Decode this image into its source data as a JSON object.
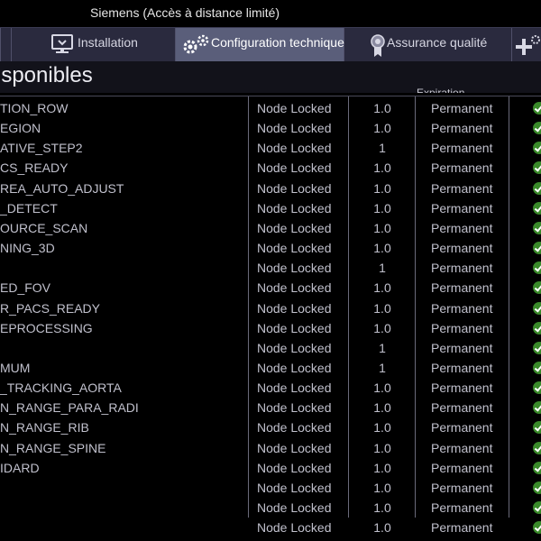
{
  "window": {
    "title": "Siemens (Accès à distance limité)"
  },
  "tabs": [
    {
      "label": "Installation",
      "icon": "monitor-icon",
      "active": false
    },
    {
      "label": "Configuration technique",
      "icon": "gears-icon",
      "active": true
    },
    {
      "label": "Assurance qualité",
      "icon": "award-icon",
      "active": false
    },
    {
      "label": "",
      "icon": "plus-gear-icon",
      "active": false
    }
  ],
  "section": {
    "title": "isponibles",
    "expiration_header": "Expiration"
  },
  "options": [
    {
      "name": "TION_ROW",
      "license": "Node Locked",
      "version": "1.0",
      "validity": "Permanent"
    },
    {
      "name": "EGION",
      "license": "Node Locked",
      "version": "1.0",
      "validity": "Permanent"
    },
    {
      "name": "ATIVE_STEP2",
      "license": "Node Locked",
      "version": "1",
      "validity": "Permanent"
    },
    {
      "name": "CS_READY",
      "license": "Node Locked",
      "version": "1.0",
      "validity": "Permanent"
    },
    {
      "name": "REA_AUTO_ADJUST",
      "license": "Node Locked",
      "version": "1.0",
      "validity": "Permanent"
    },
    {
      "name": "_DETECT",
      "license": "Node Locked",
      "version": "1.0",
      "validity": "Permanent"
    },
    {
      "name": "OURCE_SCAN",
      "license": "Node Locked",
      "version": "1.0",
      "validity": "Permanent"
    },
    {
      "name": "NING_3D",
      "license": "Node Locked",
      "version": "1.0",
      "validity": "Permanent"
    },
    {
      "name": "",
      "license": "Node Locked",
      "version": "1",
      "validity": "Permanent"
    },
    {
      "name": "ED_FOV",
      "license": "Node Locked",
      "version": "1.0",
      "validity": "Permanent"
    },
    {
      "name": "R_PACS_READY",
      "license": "Node Locked",
      "version": "1.0",
      "validity": "Permanent"
    },
    {
      "name": "EPROCESSING",
      "license": "Node Locked",
      "version": "1.0",
      "validity": "Permanent"
    },
    {
      "name": "",
      "license": "Node Locked",
      "version": "1",
      "validity": "Permanent"
    },
    {
      "name": "MUM",
      "license": "Node Locked",
      "version": "1",
      "validity": "Permanent"
    },
    {
      "name": "_TRACKING_AORTA",
      "license": "Node Locked",
      "version": "1.0",
      "validity": "Permanent"
    },
    {
      "name": "N_RANGE_PARA_RADI",
      "license": "Node Locked",
      "version": "1.0",
      "validity": "Permanent"
    },
    {
      "name": "N_RANGE_RIB",
      "license": "Node Locked",
      "version": "1.0",
      "validity": "Permanent"
    },
    {
      "name": "N_RANGE_SPINE",
      "license": "Node Locked",
      "version": "1.0",
      "validity": "Permanent"
    },
    {
      "name": "IDARD",
      "license": "Node Locked",
      "version": "1.0",
      "validity": "Permanent"
    },
    {
      "name": "",
      "license": "Node Locked",
      "version": "1.0",
      "validity": "Permanent"
    },
    {
      "name": "",
      "license": "Node Locked",
      "version": "1.0",
      "validity": "Permanent"
    },
    {
      "name": "",
      "license": "Node Locked",
      "version": "1.0",
      "validity": "Permanent"
    }
  ]
}
